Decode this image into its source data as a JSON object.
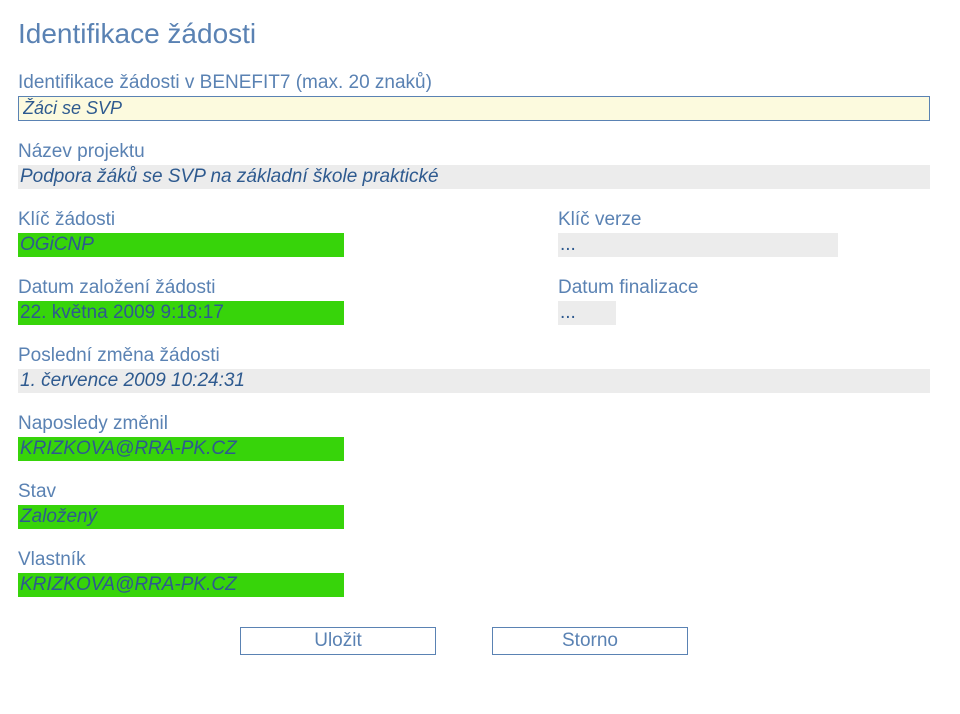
{
  "title": "Identifikace žádosti",
  "ident": {
    "label": "Identifikace žádosti v BENEFIT7 (max. 20 znaků)",
    "value": "Žáci se SVP"
  },
  "project": {
    "label": "Název projektu",
    "value": "Podpora žáků se SVP na základní škole praktické"
  },
  "requestKey": {
    "label": "Klíč žádosti",
    "value": "OGiCNP"
  },
  "versionKey": {
    "label": "Klíč verze",
    "value": "..."
  },
  "createdDate": {
    "label": "Datum založení žádosti",
    "value": "22. května 2009 9:18:17"
  },
  "finalDate": {
    "label": "Datum finalizace",
    "value": "..."
  },
  "lastChange": {
    "label": "Poslední změna žádosti",
    "value": "1. července 2009 10:24:31"
  },
  "lastChangedBy": {
    "label": "Naposledy změnil",
    "value": "KRIZKOVA@RRA-PK.CZ"
  },
  "state": {
    "label": "Stav",
    "value": "Založený"
  },
  "owner": {
    "label": "Vlastník",
    "value": "KRIZKOVA@RRA-PK.CZ"
  },
  "buttons": {
    "save": "Uložit",
    "cancel": "Storno"
  }
}
